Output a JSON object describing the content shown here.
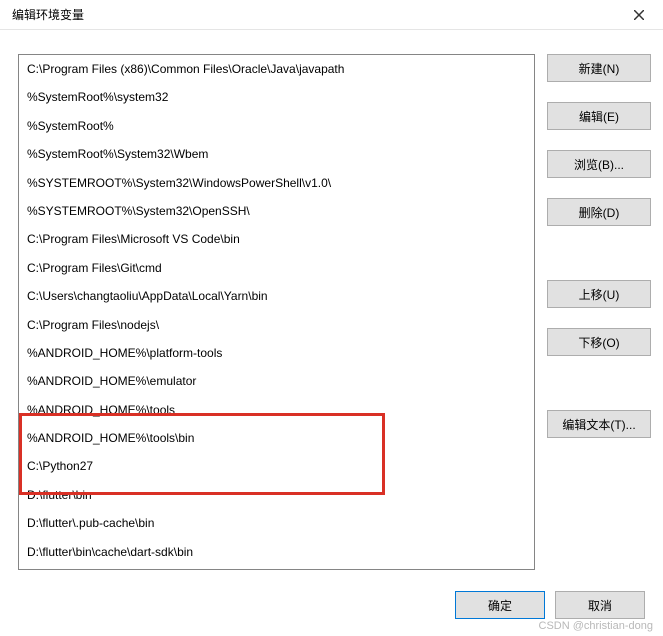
{
  "dialog": {
    "title": "编辑环境变量"
  },
  "paths": [
    "C:\\Program Files (x86)\\Common Files\\Oracle\\Java\\javapath",
    "%SystemRoot%\\system32",
    "%SystemRoot%",
    "%SystemRoot%\\System32\\Wbem",
    "%SYSTEMROOT%\\System32\\WindowsPowerShell\\v1.0\\",
    "%SYSTEMROOT%\\System32\\OpenSSH\\",
    "C:\\Program Files\\Microsoft VS Code\\bin",
    "C:\\Program Files\\Git\\cmd",
    "C:\\Users\\changtaoliu\\AppData\\Local\\Yarn\\bin",
    "C:\\Program Files\\nodejs\\",
    "%ANDROID_HOME%\\platform-tools",
    "%ANDROID_HOME%\\emulator",
    "%ANDROID_HOME%\\tools",
    "%ANDROID_HOME%\\tools\\bin",
    "C:\\Python27",
    "D:\\flutter\\bin",
    "D:\\flutter\\.pub-cache\\bin",
    "D:\\flutter\\bin\\cache\\dart-sdk\\bin"
  ],
  "buttons": {
    "new": "新建(N)",
    "edit": "编辑(E)",
    "browse": "浏览(B)...",
    "delete": "删除(D)",
    "moveup": "上移(U)",
    "movedown": "下移(O)",
    "edittext": "编辑文本(T)...",
    "ok": "确定",
    "cancel": "取消"
  },
  "watermark": "CSDN @christian-dong"
}
